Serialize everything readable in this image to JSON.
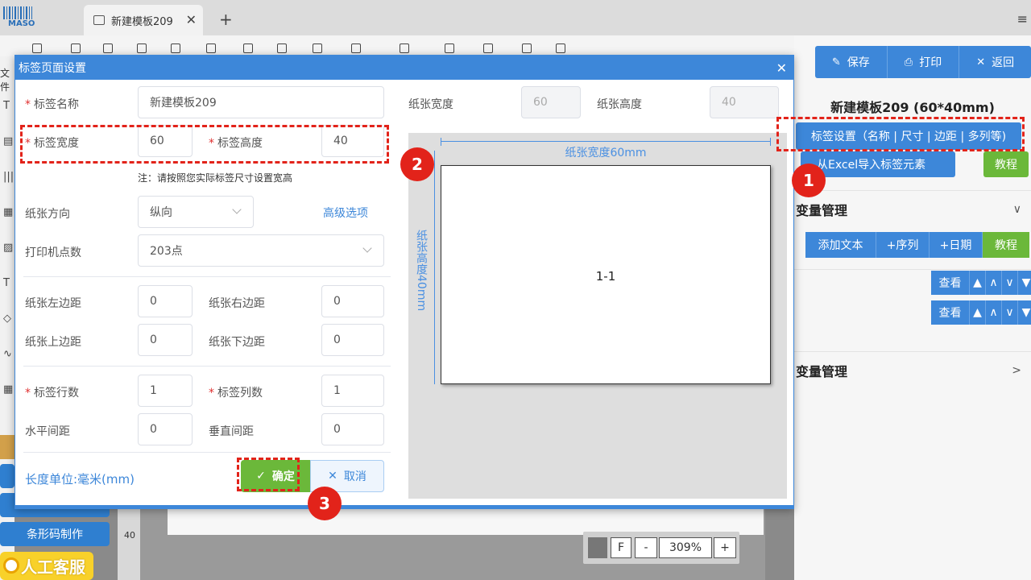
{
  "tabbar": {
    "logo_text": "MASO",
    "tab_title": "新建模板209",
    "close_glyph": "✕",
    "new_tab_glyph": "+",
    "menu_glyph": "≡"
  },
  "left_strip": {
    "top_label": "文件",
    "glyphs": [
      "T",
      "▤",
      "|||",
      "▦",
      "▨",
      "T",
      "◇",
      "∿",
      "▦"
    ]
  },
  "left_buttons": {
    "barcode_label": "条形码制作",
    "service_label": "人工客服"
  },
  "canvas": {
    "ruler_mark": "40"
  },
  "zoom": {
    "fit_label": "F",
    "minus": "-",
    "level": "309%",
    "plus": "+"
  },
  "right_panel": {
    "save": "保存",
    "print": "打印",
    "back": "返回",
    "template_title": "新建模板209 (60*40mm)",
    "label_settings": "标签设置（名称 | 尺寸 | 边距 | 多列等)",
    "excel_import": "从Excel导入标签元素",
    "tutorial": "教程",
    "var_mgmt_1": "变量管理",
    "add_text": "添加文本",
    "add_seq": "+序列",
    "add_date": "+日期",
    "view": "查看",
    "var_mgmt_2": "变量管理"
  },
  "modal": {
    "title": "标签页面设置",
    "close_glyph": "✕",
    "label_name_label": "标签名称",
    "label_name_value": "新建模板209",
    "paper_width_label": "纸张宽度",
    "paper_width_value": "60",
    "paper_height_label": "纸张高度",
    "paper_height_value": "40",
    "label_width_label": "标签宽度",
    "label_width_value": "60",
    "label_height_label": "标签高度",
    "label_height_value": "40",
    "note": "注：请按照您实际标签尺寸设置宽高",
    "orientation_label": "纸张方向",
    "orientation_value": "纵向",
    "advanced": "高级选项",
    "dpi_label": "打印机点数",
    "dpi_value": "203点",
    "left_margin_label": "纸张左边距",
    "left_margin_value": "0",
    "right_margin_label": "纸张右边距",
    "right_margin_value": "0",
    "top_margin_label": "纸张上边距",
    "top_margin_value": "0",
    "bottom_margin_label": "纸张下边距",
    "bottom_margin_value": "0",
    "rows_label": "标签行数",
    "rows_value": "1",
    "cols_label": "标签列数",
    "cols_value": "1",
    "h_gap_label": "水平间距",
    "h_gap_value": "0",
    "v_gap_label": "垂直间距",
    "v_gap_value": "0",
    "unit": "长度单位:毫米(mm)",
    "ok": "确定",
    "cancel": "取消",
    "preview_width": "纸张宽度60mm",
    "preview_height": "纸张高度40mm",
    "preview_cell": "1-1"
  },
  "markers": [
    "1",
    "2",
    "3"
  ],
  "colors": {
    "primary": "#3d87d9",
    "success": "#6bb83a",
    "annotation": "#e2231a"
  }
}
